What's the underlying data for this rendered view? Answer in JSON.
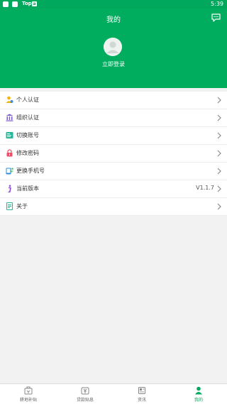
{
  "status_bar": {
    "app_label": "Top",
    "badge": "a",
    "time": "5:39"
  },
  "header": {
    "title": "我的",
    "login_label": "立即登录",
    "accent_color": "#00ad5f"
  },
  "menu": {
    "items": [
      {
        "label": "个人认证",
        "icon": "person-verify-icon"
      },
      {
        "label": "组织认证",
        "icon": "bank-building-icon"
      },
      {
        "label": "切换账号",
        "icon": "switch-account-icon"
      },
      {
        "label": "修改密码",
        "icon": "lock-icon"
      },
      {
        "label": "更换手机号",
        "icon": "phone-icon"
      },
      {
        "label": "当前版本",
        "icon": "info-icon",
        "value": "V1.1.7"
      },
      {
        "label": "关于",
        "icon": "about-document-icon"
      }
    ]
  },
  "bottom_nav": {
    "items": [
      {
        "label": "耕地补贴",
        "icon": "subsidy-icon"
      },
      {
        "label": "贷款贴息",
        "icon": "loan-icon"
      },
      {
        "label": "资讯",
        "icon": "news-icon"
      },
      {
        "label": "我的",
        "icon": "profile-icon",
        "active": true
      }
    ]
  }
}
